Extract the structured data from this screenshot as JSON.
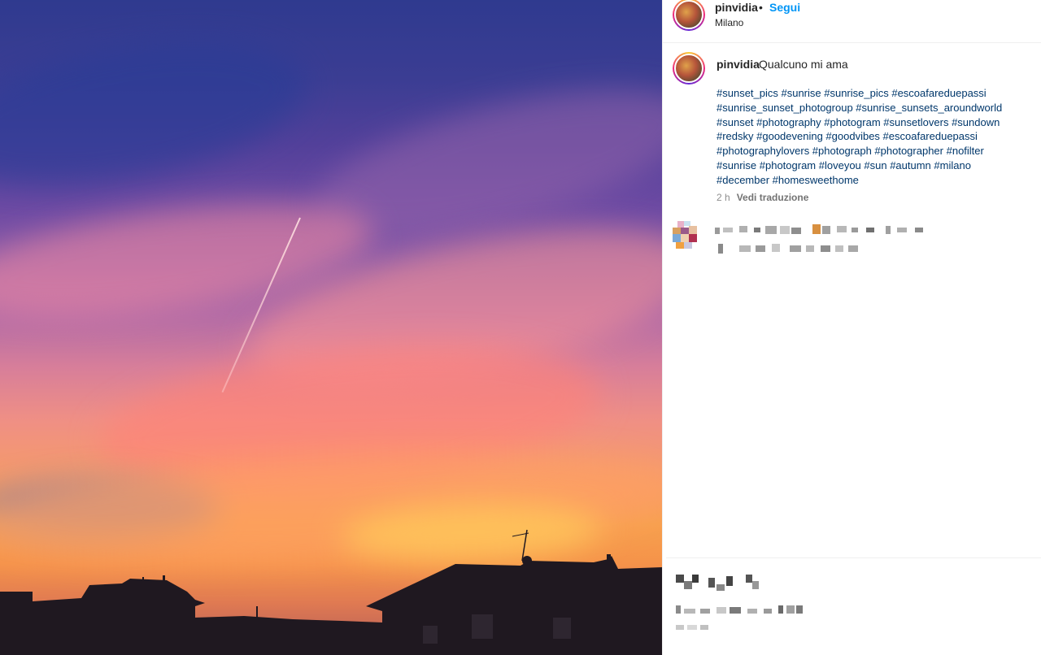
{
  "post": {
    "username": "pinvidia",
    "follow_label": "Segui",
    "location": "Milano",
    "separator": "•",
    "caption_text": "Qualcuno mi ama",
    "hashtag_lines": [
      "#sunset_pics #sunrise #sunrise_pics #escoafareduepassi",
      "#sunrise_sunset_photogroup #sunrise_sunsets_aroundworld",
      "#sunset #photography #photogram #sunsetlovers #sundown",
      "#redsky #goodevening #goodvibes #escoafareduepassi",
      "#photographylovers #photograph #photographer #nofilter",
      "#sunrise #photogram #loveyou #sun #autumn #milano",
      "#december #homesweethome"
    ],
    "time_ago": "2 h",
    "translate_label": "Vedi traduzione"
  },
  "colors": {
    "link_blue": "#0095f6",
    "hashtag": "#00376b",
    "muted": "#8e8e8e"
  },
  "icons": {
    "avatar": "user-avatar",
    "photo": "sunset-photo"
  }
}
